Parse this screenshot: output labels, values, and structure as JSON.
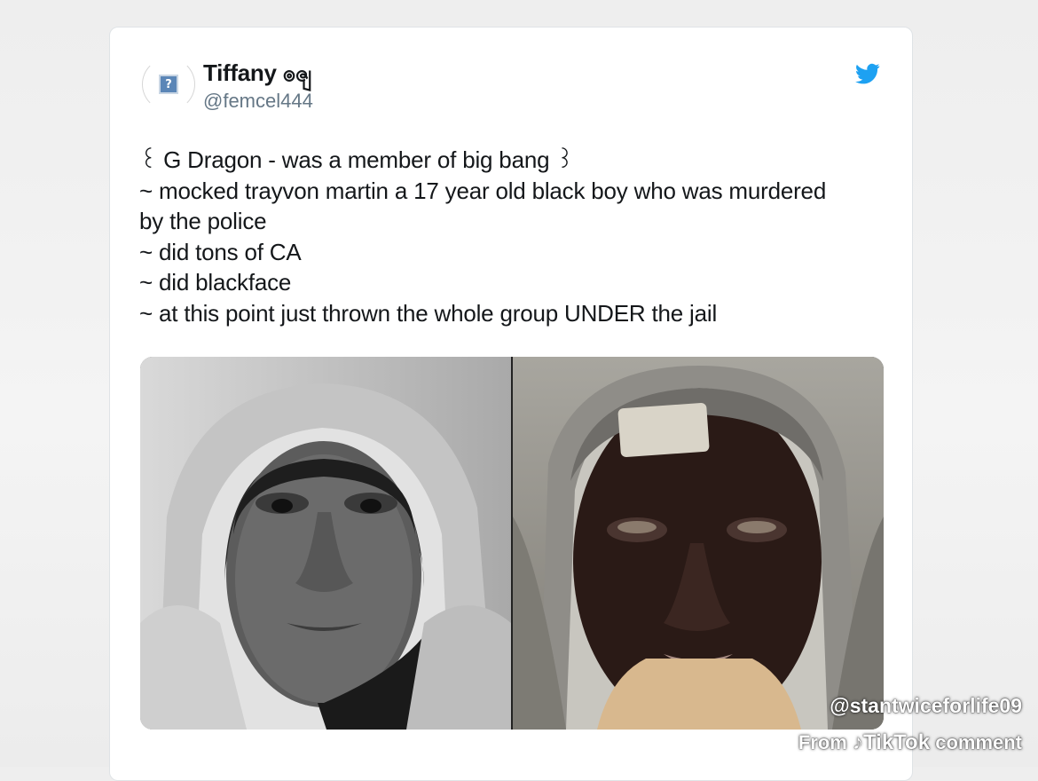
{
  "tweet": {
    "display_name": "Tiffany ၜၛ",
    "handle": "@femcel444",
    "avatar_icon": "broken-image-placeholder-icon",
    "platform_icon": "twitter-bird-icon",
    "accent_color": "#1da1f2",
    "lines": [
      "꒰ G Dragon - was a member of big bang ꒱",
      "~ mocked trayvon martin a 17 year old black boy who was murdered",
      "by the police",
      "~ did tons of CA",
      "~ did blackface",
      "~ at this point just thrown the whole group UNDER the jail"
    ]
  },
  "media": {
    "left_photo": "hooded-teen-portrait-photo",
    "right_photo": "painted-face-portrait-photo"
  },
  "watermark": {
    "username": "@stantwiceforlife09",
    "from_label": "From",
    "brand": "TikTok",
    "suffix": "comment"
  }
}
